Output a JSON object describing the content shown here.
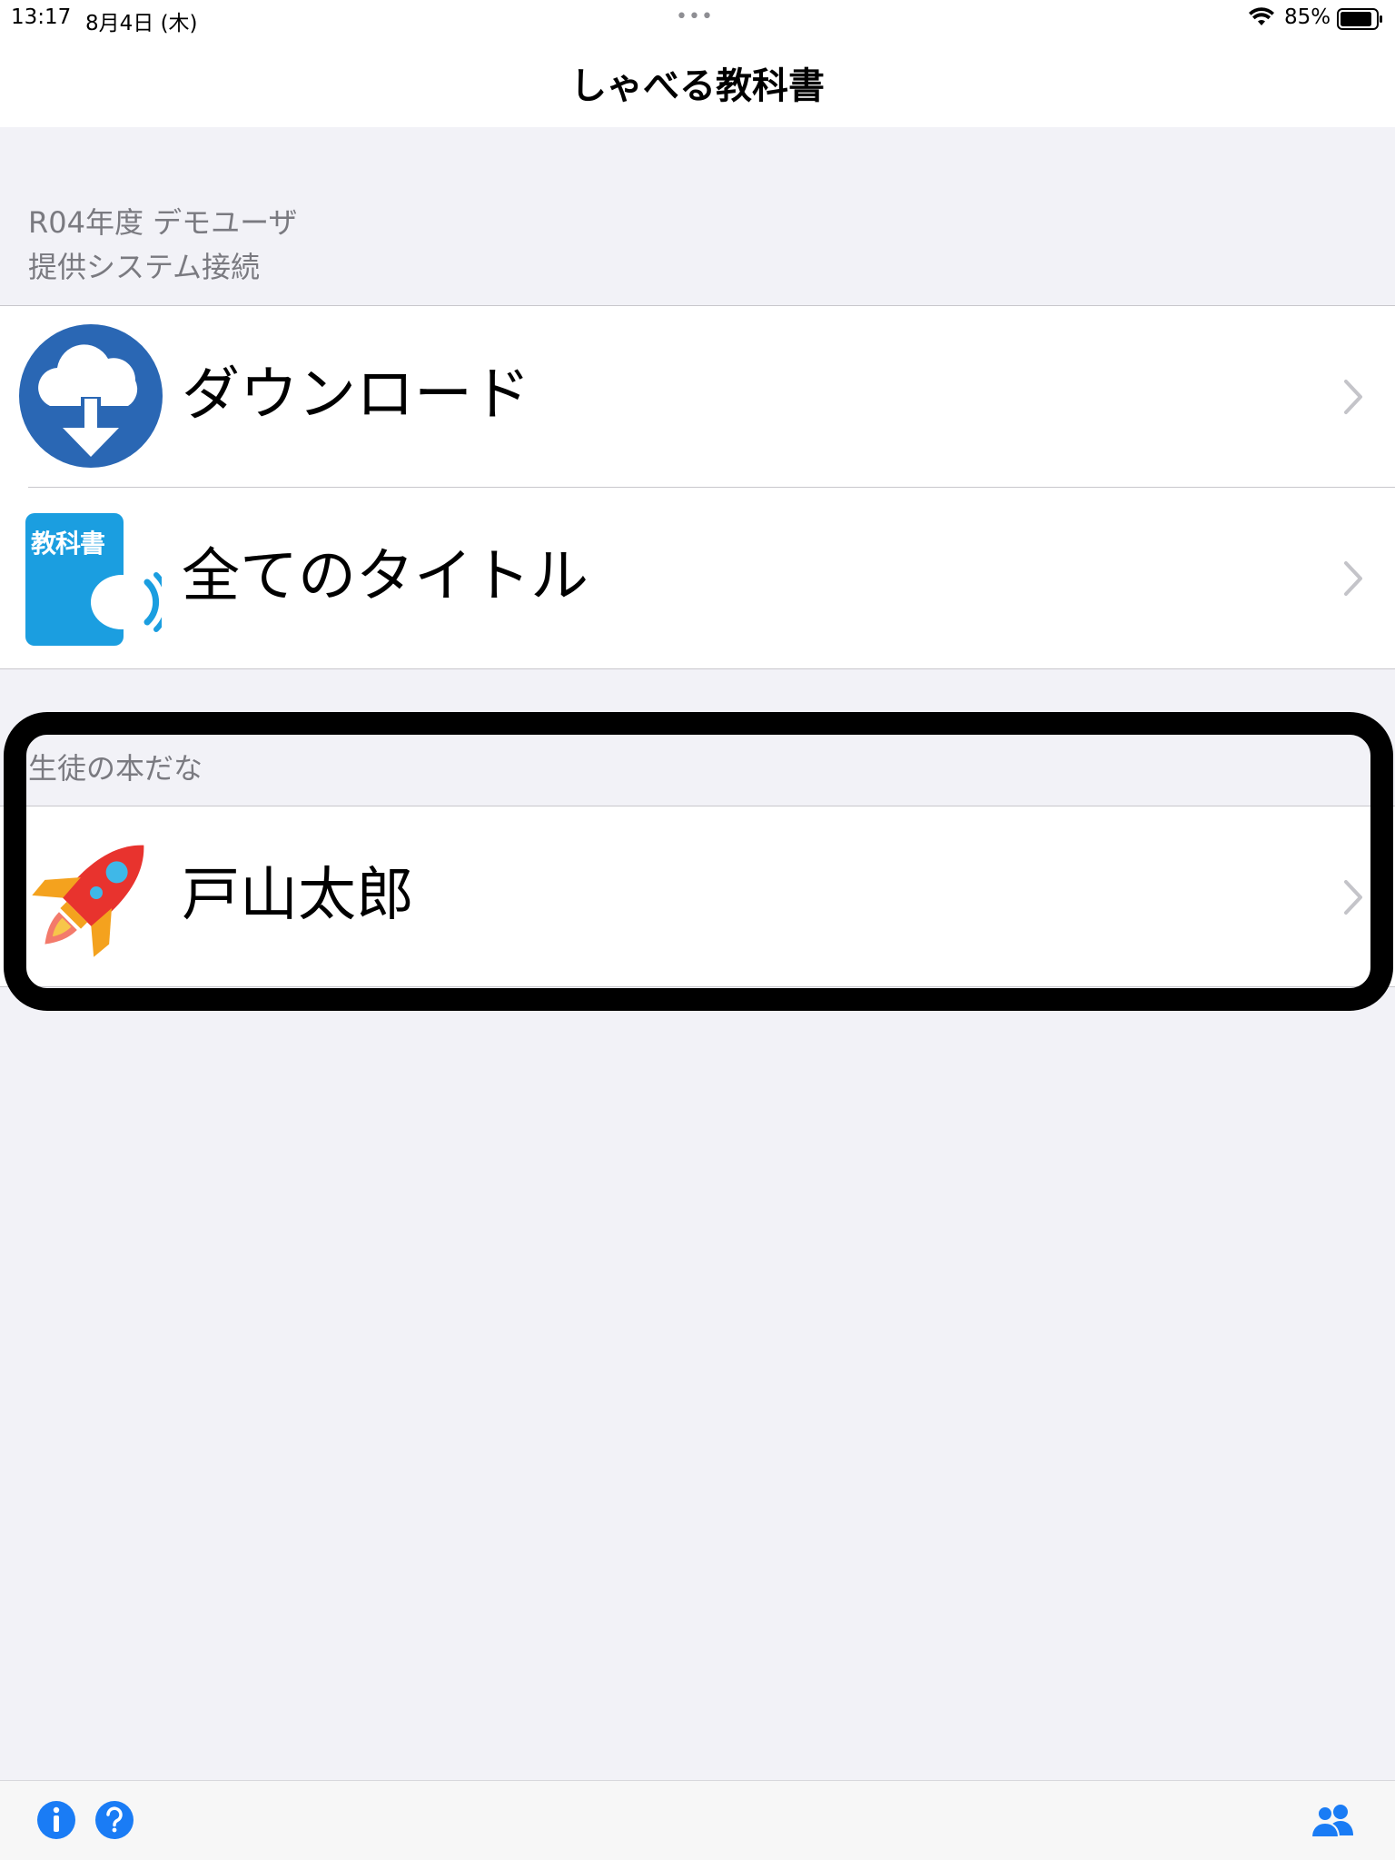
{
  "status_bar": {
    "time": "13:17",
    "date": "8月4日 (木)",
    "dots": "•••",
    "battery": "85%"
  },
  "nav": {
    "title": "しゃべる教科書"
  },
  "section1": {
    "header_line1": "R04年度 デモユーザ",
    "header_line2": "提供システム接続",
    "items": [
      {
        "label": "ダウンロード",
        "icon": "cloud-download-icon"
      },
      {
        "label": "全てのタイトル",
        "icon": "textbook-speaker-icon",
        "icon_text": "教科書"
      }
    ]
  },
  "section2": {
    "header": "生徒の本だな",
    "items": [
      {
        "label": "戸山太郎",
        "icon": "rocket-icon"
      }
    ]
  },
  "toolbar": {
    "left_icons": [
      "info-icon",
      "help-icon"
    ],
    "right_icons": [
      "users-icon"
    ]
  },
  "colors": {
    "accent": "#1a7cf5",
    "download_icon_bg": "#2a67b4",
    "textbook_icon_bg": "#1b9ee0",
    "rocket_body": "#e8332e",
    "rocket_fin": "#f4a21e",
    "highlight_border": "#000000",
    "background": "#f2f2f7"
  }
}
